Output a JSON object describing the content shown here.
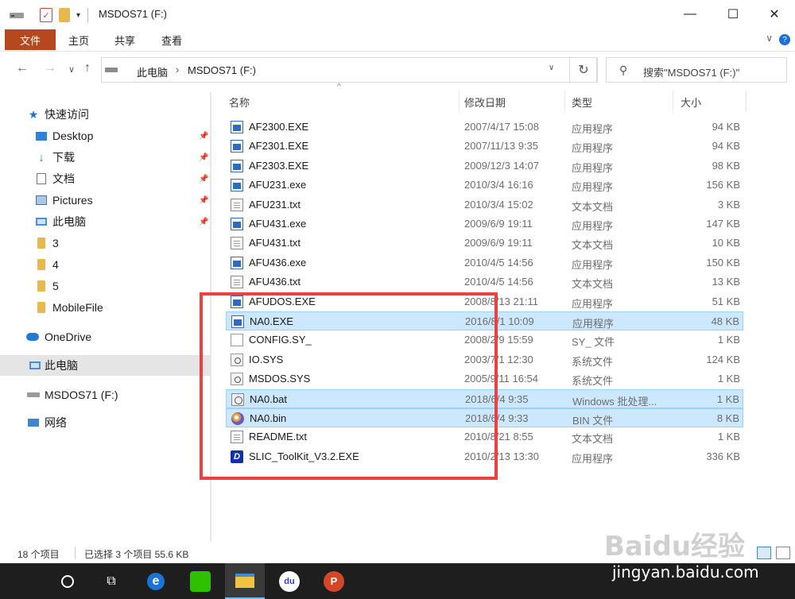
{
  "window": {
    "title": "MSDOS71 (F:)",
    "minimize": "—",
    "maximize": "☐",
    "close": "✕",
    "quick_access_dropdown": "▾"
  },
  "ribbon": {
    "file": "文件",
    "home": "主页",
    "share": "共享",
    "view": "查看",
    "expand": "∨",
    "help": "?"
  },
  "nav": {
    "back": "←",
    "forward": "→",
    "recent": "∨",
    "up": "↑",
    "breadcrumb": [
      "此电脑",
      "MSDOS71 (F:)"
    ],
    "breadcrumb_sep": "›",
    "address_dropdown": "∨",
    "refresh": "↻"
  },
  "search": {
    "icon": "search-icon",
    "placeholder": "搜索\"MSDOS71 (F:)\""
  },
  "sidebar": {
    "items": [
      {
        "label": "快速访问",
        "icon": "star-icon"
      },
      {
        "label": "Desktop",
        "icon": "desktop-folder-icon",
        "pinned": true
      },
      {
        "label": "下载",
        "icon": "download-icon",
        "pinned": true
      },
      {
        "label": "文档",
        "icon": "document-icon",
        "pinned": true
      },
      {
        "label": "Pictures",
        "icon": "pictures-icon",
        "pinned": true
      },
      {
        "label": "此电脑",
        "icon": "computer-icon",
        "pinned": true
      },
      {
        "label": "3",
        "icon": "folder-icon"
      },
      {
        "label": "4",
        "icon": "folder-icon"
      },
      {
        "label": "5",
        "icon": "folder-icon"
      },
      {
        "label": "MobileFile",
        "icon": "folder-icon"
      },
      {
        "label": "OneDrive",
        "icon": "cloud-icon"
      },
      {
        "label": "此电脑",
        "icon": "computer-icon",
        "selected": true
      },
      {
        "label": "MSDOS71 (F:)",
        "icon": "drive-icon"
      },
      {
        "label": "网络",
        "icon": "network-icon"
      }
    ]
  },
  "columns": {
    "name": "名称",
    "date": "修改日期",
    "type": "类型",
    "size": "大小",
    "sort_indicator": "^"
  },
  "files": [
    {
      "name": "AF2300.EXE",
      "date": "2007/4/17 15:08",
      "type": "应用程序",
      "size": "94 KB",
      "icon": "exe"
    },
    {
      "name": "AF2301.EXE",
      "date": "2007/11/13 9:35",
      "type": "应用程序",
      "size": "94 KB",
      "icon": "exe"
    },
    {
      "name": "AF2303.EXE",
      "date": "2009/12/3 14:07",
      "type": "应用程序",
      "size": "98 KB",
      "icon": "exe"
    },
    {
      "name": "AFU231.exe",
      "date": "2010/3/4 16:16",
      "type": "应用程序",
      "size": "156 KB",
      "icon": "exe"
    },
    {
      "name": "AFU231.txt",
      "date": "2010/3/4 15:02",
      "type": "文本文档",
      "size": "3 KB",
      "icon": "txt"
    },
    {
      "name": "AFU431.exe",
      "date": "2009/6/9 19:11",
      "type": "应用程序",
      "size": "147 KB",
      "icon": "exe"
    },
    {
      "name": "AFU431.txt",
      "date": "2009/6/9 19:11",
      "type": "文本文档",
      "size": "10 KB",
      "icon": "txt"
    },
    {
      "name": "AFU436.exe",
      "date": "2010/4/5 14:56",
      "type": "应用程序",
      "size": "150 KB",
      "icon": "exe"
    },
    {
      "name": "AFU436.txt",
      "date": "2010/4/5 14:56",
      "type": "文本文档",
      "size": "13 KB",
      "icon": "txt"
    },
    {
      "name": "AFUDOS.EXE",
      "date": "2008/8/13 21:11",
      "type": "应用程序",
      "size": "51 KB",
      "icon": "exe"
    },
    {
      "name": "NA0.EXE",
      "date": "2016/8/1 10:09",
      "type": "应用程序",
      "size": "48 KB",
      "icon": "exe",
      "selected": true
    },
    {
      "name": "CONFIG.SY_",
      "date": "2008/2/9 15:59",
      "type": "SY_ 文件",
      "size": "1 KB",
      "icon": "file"
    },
    {
      "name": "IO.SYS",
      "date": "2003/7/1 12:30",
      "type": "系统文件",
      "size": "124 KB",
      "icon": "sys"
    },
    {
      "name": "MSDOS.SYS",
      "date": "2005/9/11 16:54",
      "type": "系统文件",
      "size": "1 KB",
      "icon": "sys"
    },
    {
      "name": "NA0.bat",
      "date": "2018/6/4 9:35",
      "type": "Windows 批处理...",
      "size": "1 KB",
      "icon": "bat",
      "selected": true
    },
    {
      "name": "NA0.bin",
      "date": "2018/6/4 9:33",
      "type": "BIN 文件",
      "size": "8 KB",
      "icon": "bin",
      "selected": true
    },
    {
      "name": "README.txt",
      "date": "2010/8/21 8:55",
      "type": "文本文档",
      "size": "1 KB",
      "icon": "txt"
    },
    {
      "name": "SLIC_ToolKit_V3.2.EXE",
      "date": "2010/2/13 13:30",
      "type": "应用程序",
      "size": "336 KB",
      "icon": "slic"
    }
  ],
  "status": {
    "item_count": "18 个项目",
    "selection": "已选择 3 个项目  55.6 KB"
  },
  "taskbar": [
    "cortana-icon",
    "task-view-icon",
    "edge-icon",
    "wechat-icon",
    "file-explorer-icon",
    "baidu-icon",
    "powerpoint-icon"
  ],
  "watermark": {
    "logo": "Baidu经验",
    "url": "jingyan.baidu.com"
  },
  "colors": {
    "file_tab": "#b7471d",
    "selection": "#cce8ff",
    "highlight_box": "#ef4040"
  }
}
